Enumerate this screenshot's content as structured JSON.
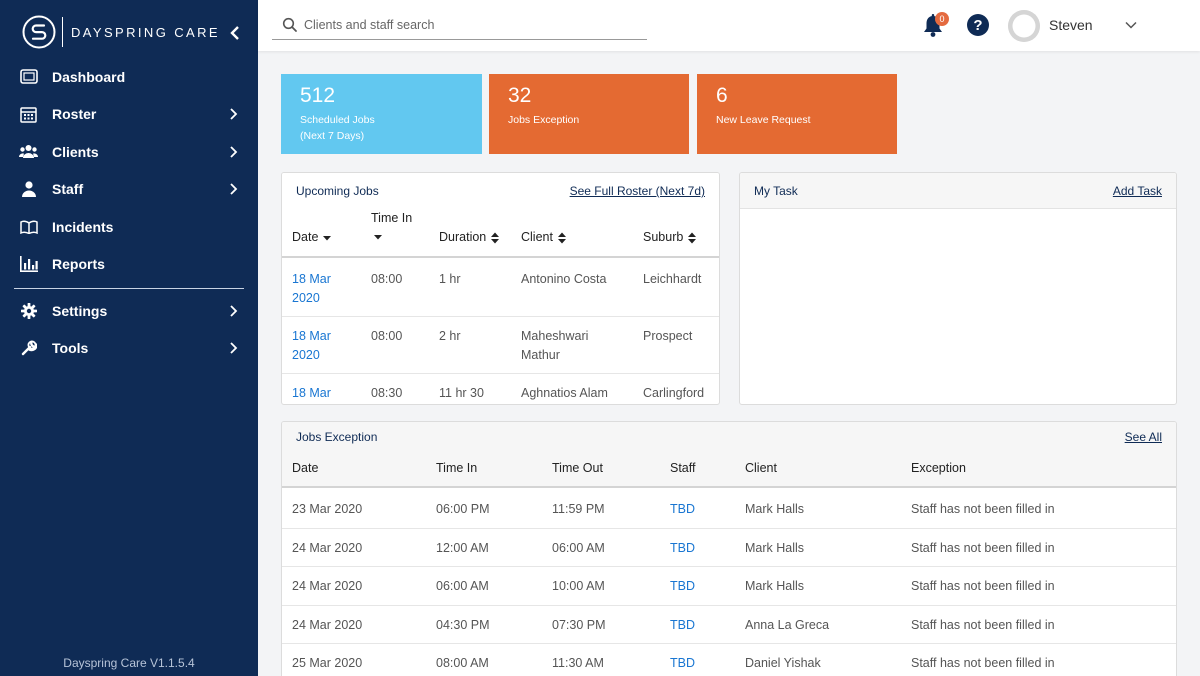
{
  "app": {
    "brand_name": "DAYSPRING CARE",
    "version": "Dayspring Care V1.1.5.4"
  },
  "sidebar": {
    "items": [
      {
        "label": "Dashboard",
        "icon": "dashboard-icon",
        "has_submenu": false
      },
      {
        "label": "Roster",
        "icon": "calendar-icon",
        "has_submenu": true
      },
      {
        "label": "Clients",
        "icon": "users-icon",
        "has_submenu": true
      },
      {
        "label": "Staff",
        "icon": "user-icon",
        "has_submenu": true
      },
      {
        "label": "Incidents",
        "icon": "book-icon",
        "has_submenu": false
      },
      {
        "label": "Reports",
        "icon": "bar-chart-icon",
        "has_submenu": false
      }
    ],
    "items_secondary": [
      {
        "label": "Settings",
        "icon": "gear-icon",
        "has_submenu": true
      },
      {
        "label": "Tools",
        "icon": "wrench-icon",
        "has_submenu": true
      }
    ]
  },
  "topbar": {
    "search_placeholder": "Clients and staff search",
    "notification_count": "0",
    "help_label": "?",
    "user_name": "Steven"
  },
  "tiles": [
    {
      "number": "512",
      "label": "Scheduled Jobs",
      "sublabel": "(Next 7 Days)",
      "color": "#62c8f0"
    },
    {
      "number": "32",
      "label": "Jobs Exception",
      "sublabel": "",
      "color": "#e46a32"
    },
    {
      "number": "6",
      "label": "New Leave Request",
      "sublabel": "",
      "color": "#e46a32"
    }
  ],
  "upcoming_jobs": {
    "title": "Upcoming Jobs",
    "link": "See Full Roster (Next 7d)",
    "columns": [
      "Date",
      "Time In",
      "Duration",
      "Client",
      "Suburb"
    ],
    "rows": [
      {
        "date_line1": "18 Mar",
        "date_line2": "2020",
        "time_in": "08:00",
        "duration": "1 hr",
        "client_line1": "Antonino Costa",
        "client_line2": "",
        "suburb": "Leichhardt"
      },
      {
        "date_line1": "18 Mar",
        "date_line2": "2020",
        "time_in": "08:00",
        "duration": "2 hr",
        "client_line1": "Maheshwari",
        "client_line2": "Mathur",
        "suburb": "Prospect"
      },
      {
        "date_line1": "18 Mar",
        "date_line2": "",
        "time_in": "08:30",
        "duration": "11 hr 30",
        "client_line1": "Aghnatios Alam",
        "client_line2": "",
        "suburb": "Carlingford"
      }
    ]
  },
  "my_task": {
    "title": "My Task",
    "link": "Add Task"
  },
  "jobs_exception": {
    "title": "Jobs Exception",
    "link": "See All",
    "columns": [
      "Date",
      "Time In",
      "Time Out",
      "Staff",
      "Client",
      "Exception"
    ],
    "rows": [
      {
        "date": "23 Mar 2020",
        "time_in": "06:00 PM",
        "time_out": "11:59 PM",
        "staff": "TBD",
        "client": "Mark Halls",
        "exception": "Staff has not been filled in"
      },
      {
        "date": "24 Mar 2020",
        "time_in": "12:00 AM",
        "time_out": "06:00 AM",
        "staff": "TBD",
        "client": "Mark Halls",
        "exception": "Staff has not been filled in"
      },
      {
        "date": "24 Mar 2020",
        "time_in": "06:00 AM",
        "time_out": "10:00 AM",
        "staff": "TBD",
        "client": "Mark Halls",
        "exception": "Staff has not been filled in"
      },
      {
        "date": "24 Mar 2020",
        "time_in": "04:30 PM",
        "time_out": "07:30 PM",
        "staff": "TBD",
        "client": "Anna La Greca",
        "exception": "Staff has not been filled in"
      },
      {
        "date": "25 Mar 2020",
        "time_in": "08:00 AM",
        "time_out": "11:30 AM",
        "staff": "TBD",
        "client": "Daniel Yishak",
        "exception": "Staff has not been filled in"
      }
    ]
  },
  "colors": {
    "sidebar_bg": "#0f2b55",
    "accent_blue": "#62c8f0",
    "accent_orange": "#e46a32",
    "link_blue": "#1976d2"
  }
}
